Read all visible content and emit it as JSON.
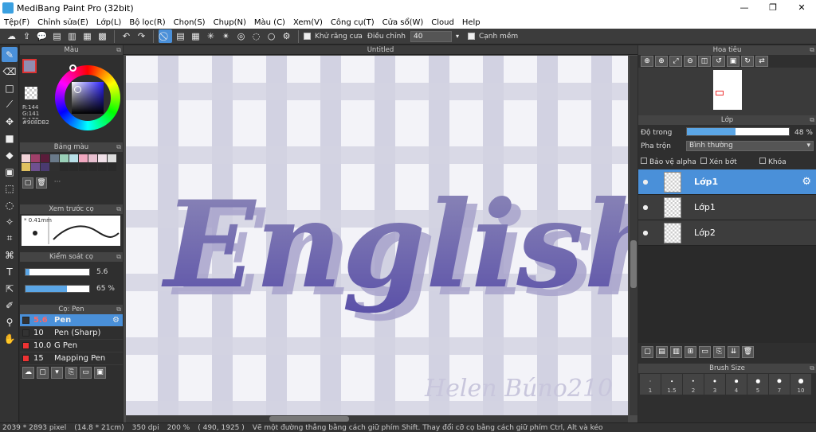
{
  "titlebar": {
    "title": "MediBang Paint Pro (32bit)",
    "minimize": "—",
    "restore": "❐",
    "close": "✕"
  },
  "menu": [
    "Tệp(F)",
    "Chỉnh sửa(E)",
    "Lớp(L)",
    "Bộ lọc(R)",
    "Chọn(S)",
    "Chụp(N)",
    "Màu (C)",
    "Xem(V)",
    "Công cụ(T)",
    "Cửa sổ(W)",
    "Cloud",
    "Help"
  ],
  "toolbar": {
    "antialias_label": "Khử răng cưa",
    "adjust_label": "Điều chỉnh",
    "adjust_value": "40",
    "smooth_label": "Cạnh mềm"
  },
  "color_panel": {
    "title": "Màu",
    "fg_color": "#908DB2",
    "rgb_lines": [
      "R:144",
      "G:141",
      "B:178"
    ],
    "hex": "#908DB2"
  },
  "palette_panel": {
    "title": "Bảng màu",
    "more": "···",
    "colors": [
      "#f2d3d8",
      "#a0406a",
      "#5a1c3a",
      "#6a7a8a",
      "#9ad0b8",
      "#b8e0e8",
      "#f0a8c0",
      "#e8c0d0",
      "#f0e0e8",
      "#ddd",
      "#e0c060",
      "#705090",
      "#4a3a70",
      "#303030",
      "#2a2a2a",
      "#2a2a2a",
      "#2a2a2a",
      "#2a2a2a",
      "#2a2a2a",
      "#2a2a2a"
    ]
  },
  "brush_preview": {
    "title": "Xem trước cọ",
    "size": "* 0.41mm"
  },
  "brush_control": {
    "title": "Kiểm soát cọ",
    "size_value": "5.6",
    "opacity_value": "65 %",
    "size_fraction": 0.06,
    "opacity_fraction": 0.65
  },
  "brush_panel": {
    "title": "Cọ: Pen",
    "items": [
      {
        "size": "5.6",
        "name": "Pen",
        "color": "#333",
        "selected": true
      },
      {
        "size": "10",
        "name": "Pen (Sharp)",
        "color": "#333",
        "selected": false
      },
      {
        "size": "10.0",
        "name": "G Pen",
        "color": "#e33",
        "selected": false
      },
      {
        "size": "15",
        "name": "Mapping Pen",
        "color": "#e33",
        "selected": false
      }
    ]
  },
  "canvas": {
    "tab_title": "Untitled",
    "art_text": "English",
    "signature": "Helen Búno210"
  },
  "navigator": {
    "title": "Hoa tiêu"
  },
  "layer_panel": {
    "title": "Lớp",
    "opacity_label": "Độ trong",
    "opacity_value": "48 %",
    "opacity_fraction": 0.48,
    "blend_label": "Pha trộn",
    "blend_value": "Bình thường",
    "protect_alpha": "Bảo vệ alpha",
    "clipping": "Xén bớt",
    "lock": "Khóa",
    "layers": [
      "Lớp1",
      "Lớp1",
      "Lớp2"
    ]
  },
  "brush_size_panel": {
    "title": "Brush Size",
    "sizes": [
      "1",
      "1.5",
      "2",
      "3",
      "4",
      "5",
      "7",
      "10"
    ]
  },
  "status": {
    "dimensions": "2039 * 2893 pixel",
    "physical": "(14.8 * 21cm)",
    "dpi": "350 dpi",
    "zoom": "200 %",
    "coords": "( 490, 1925 )",
    "hint": "Vẽ một đường thẳng bằng cách giữ phím Shift. Thay đổi cỡ cọ bằng cách giữ phím Ctrl, Alt và kéo"
  }
}
